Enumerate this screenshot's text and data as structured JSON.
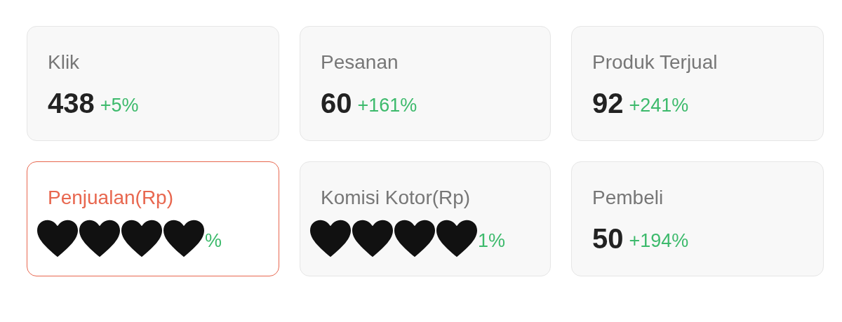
{
  "metrics": [
    {
      "label": "Klik",
      "value": "438",
      "change": "+5%",
      "selected": false,
      "covered": false
    },
    {
      "label": "Pesanan",
      "value": "60",
      "change": "+161%",
      "selected": false,
      "covered": false
    },
    {
      "label": "Produk Terjual",
      "value": "92",
      "change": "+241%",
      "selected": false,
      "covered": false
    },
    {
      "label": "Penjualan(Rp)",
      "change": "%",
      "selected": true,
      "covered": true
    },
    {
      "label": "Komisi Kotor(Rp)",
      "change": "1%",
      "selected": false,
      "covered": true
    },
    {
      "label": "Pembeli",
      "value": "50",
      "change": "+194%",
      "selected": false,
      "covered": false
    }
  ]
}
